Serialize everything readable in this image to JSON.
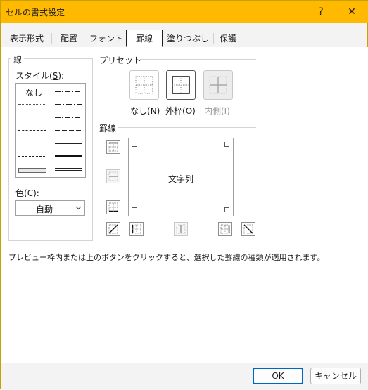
{
  "window": {
    "title": "セルの書式設定",
    "help_glyph": "?",
    "close_glyph": "✕"
  },
  "tabs": [
    {
      "label": "表示形式",
      "active": false
    },
    {
      "label": "配置",
      "active": false
    },
    {
      "label": "フォント",
      "active": false
    },
    {
      "label": "罫線",
      "active": true
    },
    {
      "label": "塗りつぶし",
      "active": false
    },
    {
      "label": "保護",
      "active": false
    }
  ],
  "line_group": {
    "title": "線",
    "style_label": "スタイル(",
    "style_key": "S",
    "style_suffix": "):",
    "none_label": "なし",
    "color_label": "色(",
    "color_key": "C",
    "color_suffix": "):",
    "color_value": "自動"
  },
  "preset": {
    "title": "プリセット",
    "buttons": [
      {
        "label": "なし(",
        "key": "N",
        "suffix": ")",
        "enabled": true
      },
      {
        "label": "外枠(",
        "key": "O",
        "suffix": ")",
        "enabled": true
      },
      {
        "label": "内側(I)",
        "key": "",
        "suffix": "",
        "enabled": false
      }
    ]
  },
  "border": {
    "title": "罫線",
    "preview_text": "文字列"
  },
  "help_text": "プレビュー枠内または上のボタンをクリックすると、選択した罫線の種類が適用されます。",
  "footer": {
    "ok": "OK",
    "cancel": "キャンセル"
  },
  "colors": {
    "title_bar": "#ffb900",
    "primary_border": "#0067c0"
  },
  "icons": {
    "help": "question-icon",
    "close": "close-icon",
    "dropdown": "chevron-down-icon"
  }
}
